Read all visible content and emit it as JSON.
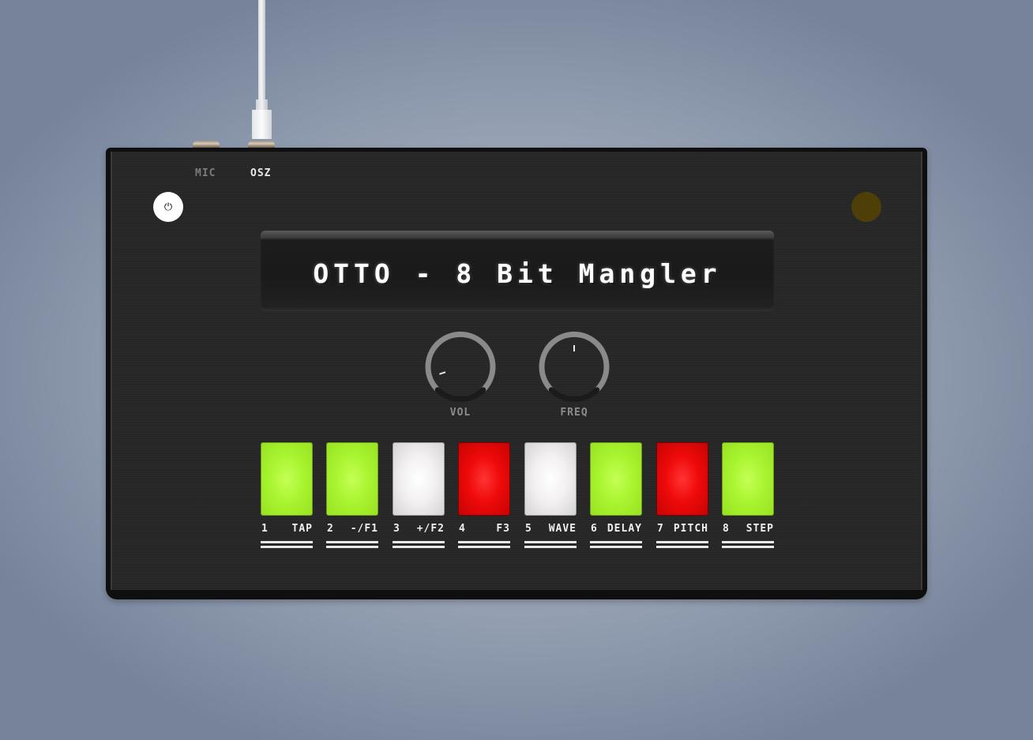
{
  "ports": [
    {
      "label": "MIC",
      "active": false
    },
    {
      "label": "OSZ",
      "active": true
    }
  ],
  "power": {
    "icon": "power-icon",
    "glyph": "⏻"
  },
  "status_led": {
    "color": "#4e3f08",
    "lit": false
  },
  "display": {
    "text": "OTTO - 8 Bit Mangler"
  },
  "knobs": [
    {
      "label": "VOL",
      "value": 0.1
    },
    {
      "label": "FREQ",
      "value": 0.5
    }
  ],
  "pads": [
    {
      "number": "1",
      "name": "TAP",
      "color": "green"
    },
    {
      "number": "2",
      "name": "-/F1",
      "color": "green"
    },
    {
      "number": "3",
      "name": "+/F2",
      "color": "white"
    },
    {
      "number": "4",
      "name": "F3",
      "color": "red"
    },
    {
      "number": "5",
      "name": "WAVE",
      "color": "white"
    },
    {
      "number": "6",
      "name": "DELAY",
      "color": "green"
    },
    {
      "number": "7",
      "name": "PITCH",
      "color": "red"
    },
    {
      "number": "8",
      "name": "STEP",
      "color": "green"
    }
  ],
  "colors": {
    "green": "#aaf531",
    "white": "#f3f1f2",
    "red": "#f00a0a",
    "body": "#262626"
  }
}
